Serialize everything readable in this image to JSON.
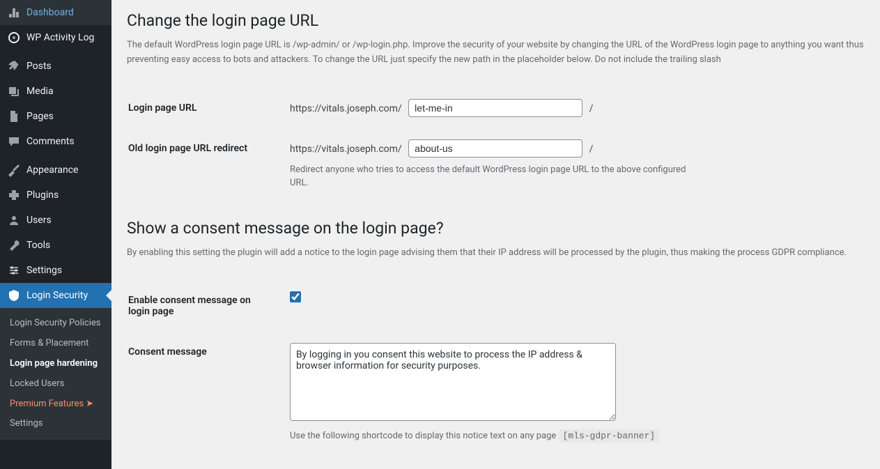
{
  "sidebar": {
    "items": [
      {
        "label": "Dashboard",
        "icon": "dashboard"
      },
      {
        "label": "WP Activity Log",
        "icon": "activity"
      },
      {
        "label": "Posts",
        "icon": "pin"
      },
      {
        "label": "Media",
        "icon": "media"
      },
      {
        "label": "Pages",
        "icon": "page"
      },
      {
        "label": "Comments",
        "icon": "comment"
      },
      {
        "label": "Appearance",
        "icon": "appearance"
      },
      {
        "label": "Plugins",
        "icon": "plugin"
      },
      {
        "label": "Users",
        "icon": "user"
      },
      {
        "label": "Tools",
        "icon": "tool"
      },
      {
        "label": "Settings",
        "icon": "settings"
      },
      {
        "label": "Login Security",
        "icon": "shield"
      }
    ],
    "submenu": [
      {
        "label": "Login Security Policies"
      },
      {
        "label": "Forms & Placement"
      },
      {
        "label": "Login page hardening"
      },
      {
        "label": "Locked Users"
      },
      {
        "label": "Premium Features ➤"
      },
      {
        "label": "Settings"
      }
    ]
  },
  "main": {
    "h_change_url": "Change the login page URL",
    "desc_change_url": "The default WordPress login page URL is /wp-admin/ or /wp-login.php. Improve the security of your website by changing the URL of the WordPress login page to anything you want thus preventing easy access to bots and attackers. To change the URL just specify the new path in the placeholder below. Do not include the trailing slash",
    "login_url_label": "Login page URL",
    "site_prefix": "https://vitals.joseph.com/",
    "slash": "/",
    "login_url_value": "let-me-in",
    "old_url_label": "Old login page URL redirect",
    "old_url_value": "about-us",
    "old_url_help": "Redirect anyone who tries to access the default WordPress login page URL to the above configured URL.",
    "h_consent": "Show a consent message on the login page?",
    "desc_consent": "By enabling this setting the plugin will add a notice to the login page advising them that their IP address will be processed by the plugin, thus making the process GDPR compliance.",
    "enable_consent_label": "Enable consent message on login page",
    "consent_msg_label": "Consent message",
    "consent_msg_value": "By logging in you consent this website to process the IP address & browser information for security purposes.",
    "shortcode_help": "Use the following shortcode to display this notice text on any page ",
    "shortcode": "[mls-gdpr-banner]"
  }
}
